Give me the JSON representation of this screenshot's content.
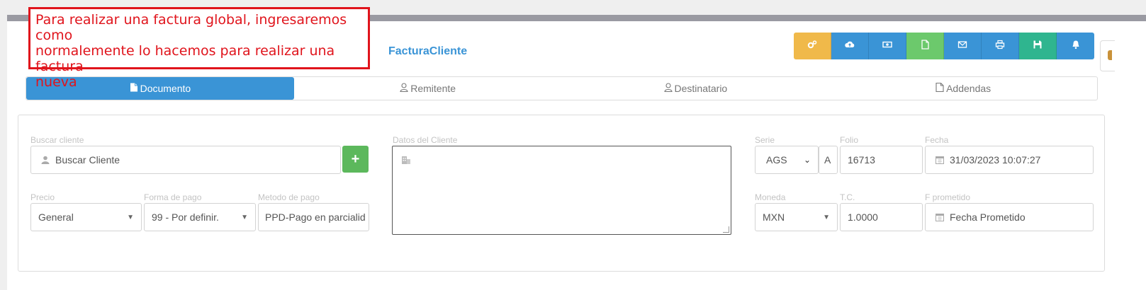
{
  "annotation": {
    "lines": [
      "Para realizar una factura global, ingresaremos como",
      "normalemente lo hacemos para realizar una factura",
      "nueva"
    ]
  },
  "page_title": "FacturaCliente",
  "toolbar": [
    {
      "icon": "cogs-icon",
      "color": "#f0b94a"
    },
    {
      "icon": "cloud-upload-icon",
      "color": "#3a94d6"
    },
    {
      "icon": "money-icon",
      "color": "#3a94d6"
    },
    {
      "icon": "document-icon",
      "color": "#6cc96c"
    },
    {
      "icon": "envelope-icon",
      "color": "#3a94d6"
    },
    {
      "icon": "print-icon",
      "color": "#3a94d6"
    },
    {
      "icon": "save-icon",
      "color": "#2fb58f"
    },
    {
      "icon": "bell-icon",
      "color": "#3a94d6"
    }
  ],
  "tabs": [
    {
      "label": "Documento",
      "icon": "file-icon",
      "active": true
    },
    {
      "label": "Remitente",
      "icon": "user-icon",
      "active": false
    },
    {
      "label": "Destinatario",
      "icon": "user-icon",
      "active": false
    },
    {
      "label": "Addendas",
      "icon": "file-outline-icon",
      "active": false
    }
  ],
  "form": {
    "buscar_cliente_label": "Buscar cliente",
    "buscar_cliente_placeholder": "Buscar Cliente",
    "add_button": "+",
    "precio_label": "Precio",
    "precio_value": "General",
    "forma_pago_label": "Forma de pago",
    "forma_pago_value": "99 - Por definir.",
    "metodo_pago_label": "Metodo de pago",
    "metodo_pago_value": "PPD-Pago en parcialid",
    "datos_cliente_label": "Datos del Cliente",
    "serie_label": "Serie",
    "serie_value": "AGS",
    "serie_extra_value": "A",
    "folio_label": "Folio",
    "folio_value": "16713",
    "fecha_label": "Fecha",
    "fecha_value": "31/03/2023 10:07:27",
    "moneda_label": "Moneda",
    "moneda_value": "MXN",
    "tc_label": "T.C.",
    "tc_value": "1.0000",
    "f_prometido_label": "F prometido",
    "f_prometido_placeholder": "Fecha Prometido"
  }
}
